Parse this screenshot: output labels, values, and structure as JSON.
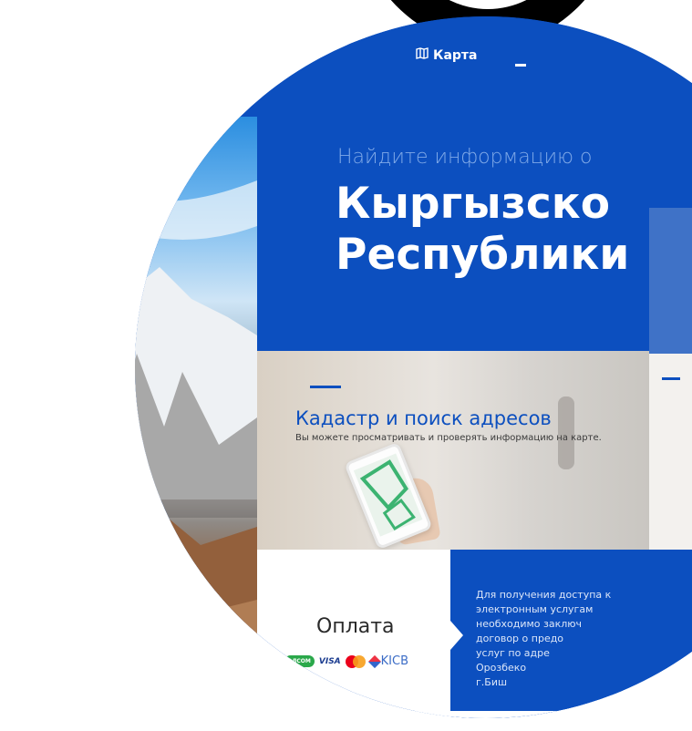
{
  "header": {
    "nav_map_label": "Карта",
    "nav_map_icon": "map-icon"
  },
  "hero": {
    "subtitle": "Найдите информацию о",
    "title_line1": "Кыргызско",
    "title_line2": "Республики"
  },
  "cards": {
    "cadastre": {
      "title": "Кадастр и поиск адресов",
      "description": "Вы можете просматривать и проверять информацию на карте."
    },
    "payment": {
      "title": "Оплата",
      "logos": [
        "ЭЛСОМ",
        "VISA",
        "MasterCard",
        "KICB"
      ]
    },
    "access": {
      "lines": [
        "Для получения доступа к",
        "электронным услугам",
        "необходимо заключ",
        "договор о предо",
        "услуг по адре",
        "Орозбеко",
        "г.Биш"
      ]
    }
  },
  "colors": {
    "primary_blue": "#0c4fbf",
    "subtitle_blue": "#7fa9e8",
    "text_dark": "#2a2a2a"
  }
}
